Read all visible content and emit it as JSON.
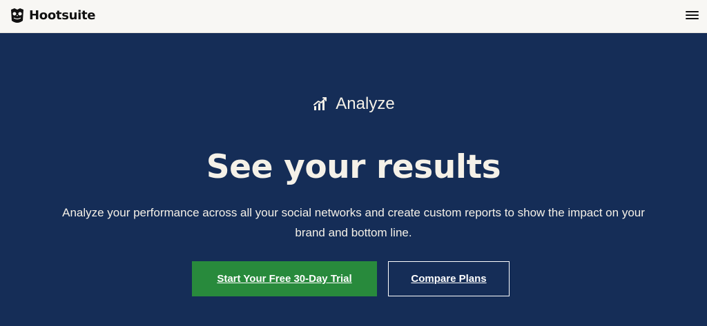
{
  "header": {
    "brand": {
      "name": "Hootsuite",
      "logo_icon": "owl-logo-icon"
    },
    "menu_icon": "hamburger-menu-icon"
  },
  "hero": {
    "eyebrow": {
      "icon": "bar-chart-trend-icon",
      "label": "Analyze"
    },
    "headline": "See your results",
    "description": "Analyze your performance across all your social networks and create custom reports to show the impact on your brand and bottom line.",
    "buttons": [
      {
        "label": "Start Your Free 30-Day Trial",
        "style": "primary"
      },
      {
        "label": "Compare Plans",
        "style": "secondary"
      }
    ]
  },
  "colors": {
    "header_background": "#f8f7f4",
    "hero_background": "#152d57",
    "primary_button": "#288a3c",
    "text_on_dark": "#f5f1e8"
  }
}
